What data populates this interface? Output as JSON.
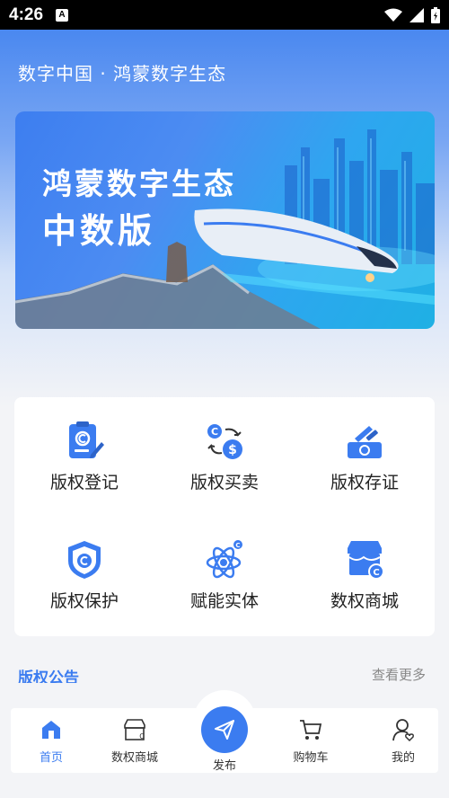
{
  "status_bar": {
    "time": "4:26",
    "app_badge": "A"
  },
  "header": {
    "subtitle": "数字中国 · 鸿蒙数字生态"
  },
  "banner": {
    "line1": "鸿蒙数字生态",
    "line2": "中数版"
  },
  "services": [
    {
      "label": "版权登记",
      "icon": "copyright-register-icon"
    },
    {
      "label": "版权买卖",
      "icon": "copyright-trade-icon"
    },
    {
      "label": "版权存证",
      "icon": "copyright-evidence-icon"
    },
    {
      "label": "版权保护",
      "icon": "copyright-protect-shield-icon"
    },
    {
      "label": "赋能实体",
      "icon": "atom-icon"
    },
    {
      "label": "数权商城",
      "icon": "store-icon"
    }
  ],
  "notice": {
    "title": "版权公告",
    "more": "查看更多"
  },
  "tabbar": {
    "items": [
      {
        "label": "首页",
        "icon": "home-icon",
        "active": true
      },
      {
        "label": "数权商城",
        "icon": "shop-icon",
        "active": false
      },
      {
        "label": "发布",
        "icon": "send-icon",
        "active": false
      },
      {
        "label": "购物车",
        "icon": "cart-icon",
        "active": false
      },
      {
        "label": "我的",
        "icon": "profile-icon",
        "active": false
      }
    ]
  },
  "colors": {
    "accent": "#3b7cf0",
    "header_top": "#4a88f0",
    "background": "#f3f4f7"
  }
}
